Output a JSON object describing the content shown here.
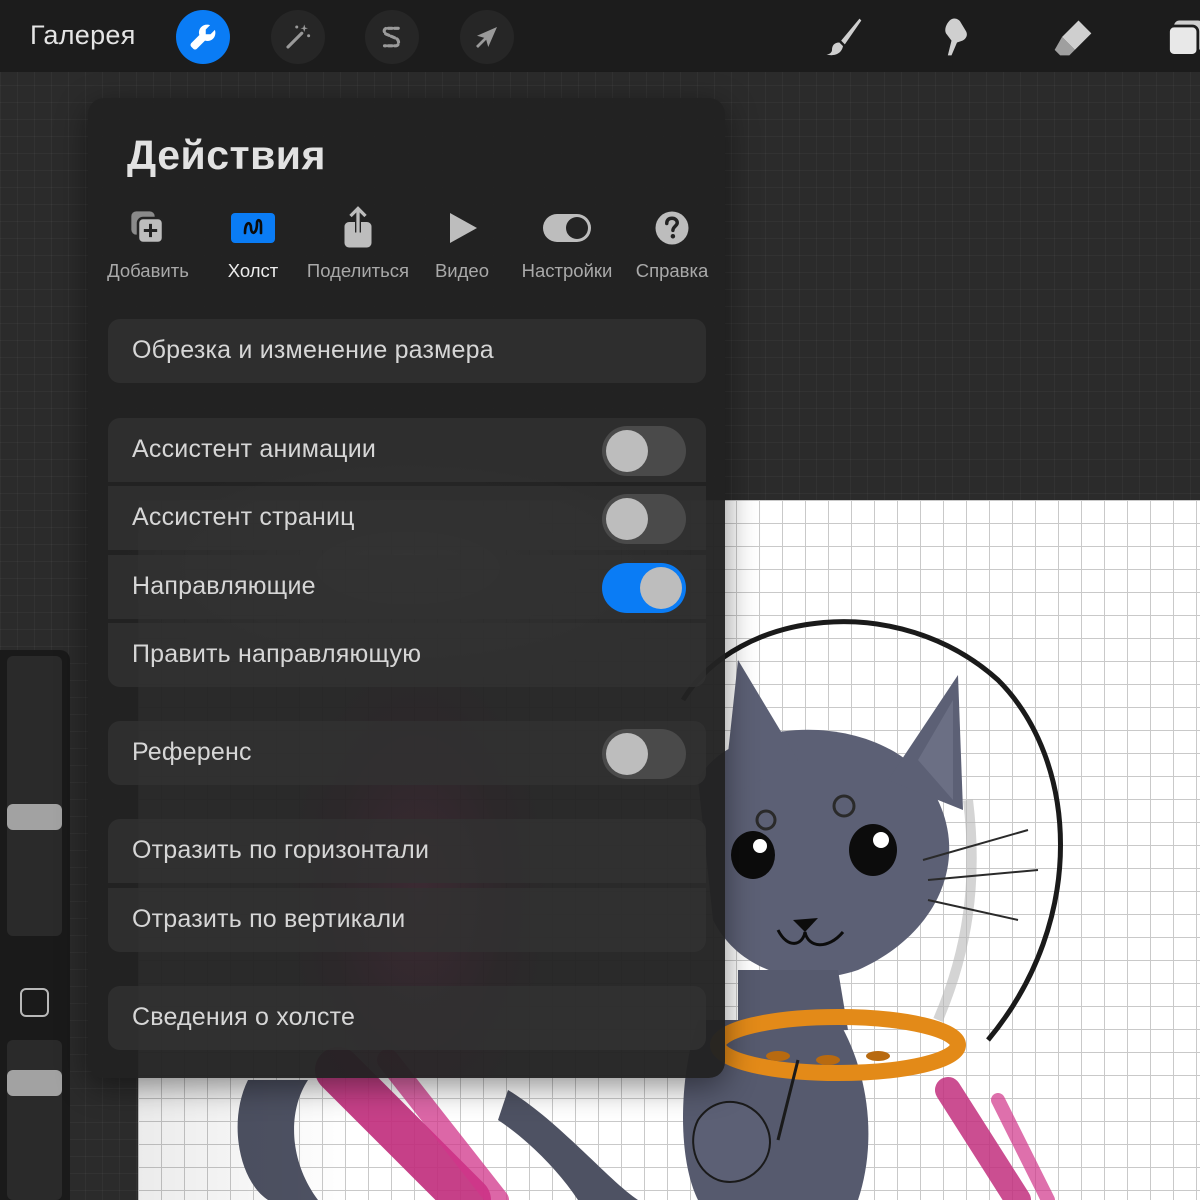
{
  "topbar": {
    "gallery_label": "Галерея",
    "left_tools": [
      {
        "icon": "wrench-icon",
        "active": true
      },
      {
        "icon": "magic-wand-icon",
        "active": false
      },
      {
        "icon": "selection-s-icon",
        "active": false
      },
      {
        "icon": "move-arrow-icon",
        "active": false
      }
    ],
    "right_tools": [
      "brush-icon",
      "smudge-icon",
      "eraser-icon",
      "layers-icon"
    ],
    "accent_color": "#0a7cf5"
  },
  "actions_panel": {
    "title": "Действия",
    "tabs": [
      {
        "label": "Добавить",
        "icon": "add-icon",
        "active": false
      },
      {
        "label": "Холст",
        "icon": "canvas-icon",
        "active": true
      },
      {
        "label": "Поделиться",
        "icon": "share-icon",
        "active": false
      },
      {
        "label": "Видео",
        "icon": "play-icon",
        "active": false
      },
      {
        "label": "Настройки",
        "icon": "toggle-icon",
        "active": false
      },
      {
        "label": "Справка",
        "icon": "help-icon",
        "active": false
      }
    ],
    "items": {
      "crop_resize": "Обрезка и изменение размера",
      "animation_assist": {
        "label": "Ассистент анимации",
        "on": false
      },
      "page_assist": {
        "label": "Ассистент страниц",
        "on": false
      },
      "drawing_guide": {
        "label": "Направляющие",
        "on": true
      },
      "edit_guide": "Править направляющую",
      "reference": {
        "label": "Референс",
        "on": false
      },
      "flip_horizontal": "Отразить по горизонтали",
      "flip_vertical": "Отразить по вертикали",
      "canvas_info": "Сведения о холсте"
    }
  },
  "sidebar": {
    "brush_size_level": 0.55,
    "opacity_level": 0.9
  }
}
